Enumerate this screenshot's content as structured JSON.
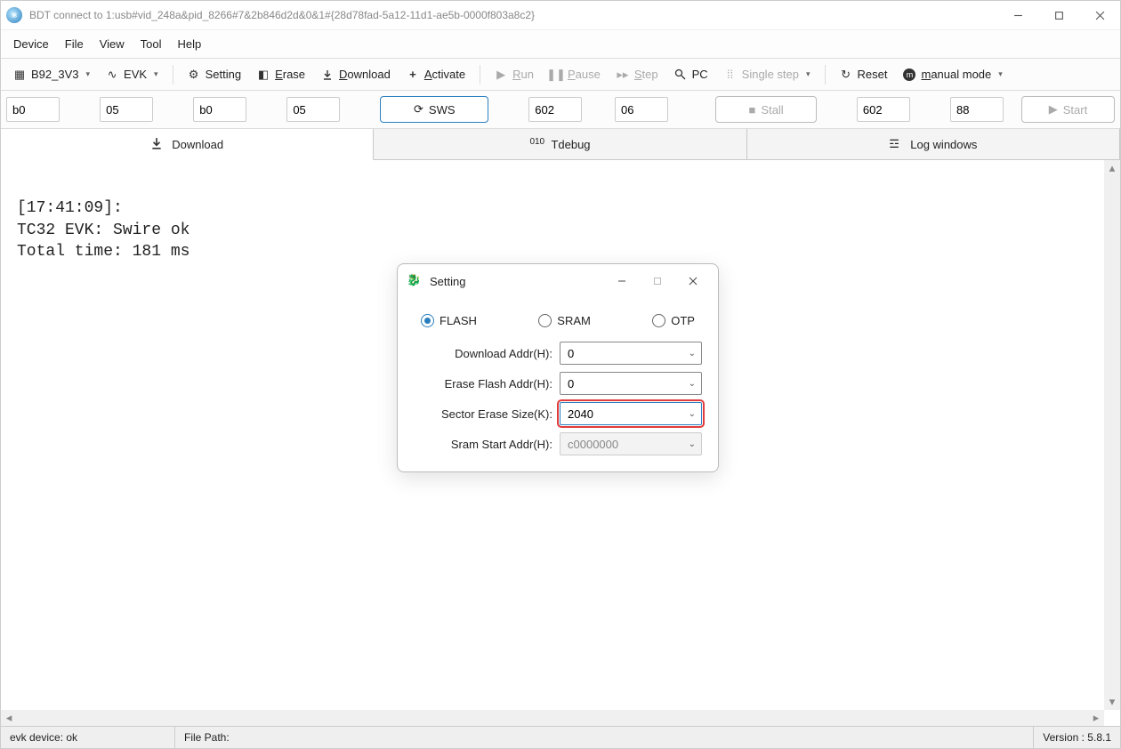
{
  "window": {
    "title": "BDT connect to 1:usb#vid_248a&pid_8266#7&2b846d2d&0&1#{28d78fad-5a12-11d1-ae5b-0000f803a8c2}"
  },
  "menubar": [
    "Device",
    "File",
    "View",
    "Tool",
    "Help"
  ],
  "toolbar": {
    "chip_selector": "B92_3V3",
    "board_selector": "EVK",
    "setting": "Setting",
    "erase": "Erase",
    "download": "Download",
    "activate": "Activate",
    "run": "Run",
    "pause": "Pause",
    "step": "Step",
    "pc": "PC",
    "single_step": "Single step",
    "reset": "Reset",
    "manual_mode": "manual mode"
  },
  "inputs": {
    "v1": "b0",
    "v2": "05",
    "v3": "b0",
    "v4": "05",
    "sws_btn": "SWS",
    "v5": "602",
    "v6": "06",
    "stall_btn": "Stall",
    "v7": "602",
    "v8": "88",
    "start_btn": "Start"
  },
  "tabs": {
    "download": "Download",
    "tdebug": "Tdebug",
    "logwin": "Log windows"
  },
  "console_text": "\n[17:41:09]:\nTC32 EVK: Swire ok\nTotal time: 181 ms",
  "status": {
    "device": "evk device: ok",
    "filepath_label": "File Path:",
    "version": "Version : 5.8.1"
  },
  "modal": {
    "title": "Setting",
    "radios": {
      "flash": "FLASH",
      "sram": "SRAM",
      "otp": "OTP"
    },
    "rows": {
      "download_addr_label": "Download  Addr(H):",
      "download_addr_value": "0",
      "erase_addr_label": "Erase Flash Addr(H):",
      "erase_addr_value": "0",
      "sector_label": "Sector Erase Size(K):",
      "sector_value": "2040",
      "sram_label": "Sram Start Addr(H):",
      "sram_value": "c0000000"
    }
  }
}
